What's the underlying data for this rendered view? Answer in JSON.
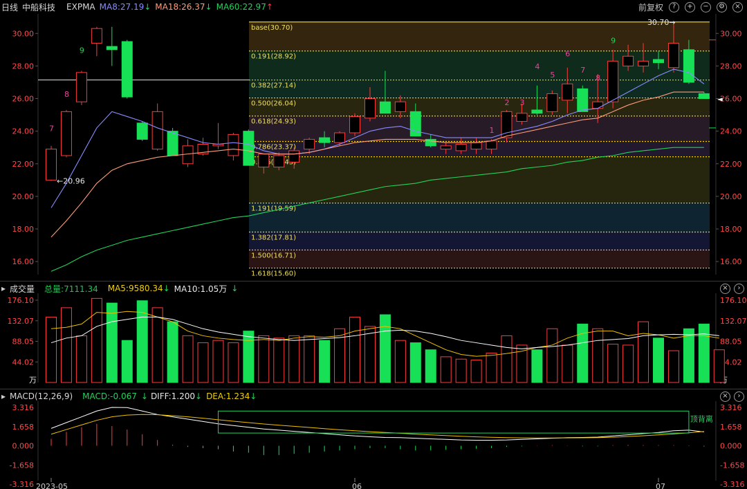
{
  "header": {
    "period_label": "日线",
    "stock_name": "中船科技",
    "indicator": "EXPMA",
    "ma8": "MA8:27.19",
    "ma18": "MA18:26.37",
    "ma60": "MA60:22.97",
    "arrow_down": "↓",
    "arrow_up": "↑",
    "adjust_label": "前复权",
    "ma8_color": "#8a8cff",
    "ma18_color": "#ff9c7a",
    "ma60_color": "#22d35a"
  },
  "price_axis": {
    "ticks": [
      "30.00",
      "28.00",
      "26.00",
      "24.00",
      "22.00",
      "20.00",
      "18.00",
      "16.00"
    ],
    "tick_values": [
      30,
      28,
      26,
      24,
      22,
      20,
      18,
      16
    ],
    "ylim": [
      15.2,
      31.2
    ]
  },
  "price_annotations": {
    "low_label": "←20.96",
    "high_label": "30.70→",
    "current_marker": "◄"
  },
  "fib_levels": [
    {
      "label": "base(30.70)",
      "value": 30.7
    },
    {
      "label": "0.191(28.92)",
      "value": 28.92
    },
    {
      "label": "0.382(27.14)",
      "value": 27.14
    },
    {
      "label": "0.500(26.04)",
      "value": 26.04
    },
    {
      "label": "0.618(24.93)",
      "value": 24.93
    },
    {
      "label": "0.786(23.37)",
      "value": 23.37
    },
    {
      "label": "0.886(22.43)",
      "value": 22.43
    },
    {
      "label": "1.191(19.59)",
      "value": 19.59
    },
    {
      "label": "1.382(17.81)",
      "value": 17.81
    },
    {
      "label": "1.500(16.71)",
      "value": 16.71
    },
    {
      "label": "1.618(15.60)",
      "value": 15.6
    }
  ],
  "chart_data": [
    {
      "type": "candlestick",
      "title": "日线 中船科技",
      "ylim": [
        15.2,
        31.2
      ],
      "candles": [
        {
          "o": 21.0,
          "h": 23.1,
          "l": 20.96,
          "c": 22.9
        },
        {
          "o": 22.5,
          "h": 25.3,
          "l": 22.4,
          "c": 25.2
        },
        {
          "o": 25.8,
          "h": 27.7,
          "l": 25.6,
          "c": 27.6
        },
        {
          "o": 29.4,
          "h": 30.4,
          "l": 28.6,
          "c": 30.3
        },
        {
          "o": 29.2,
          "h": 30.4,
          "l": 28.0,
          "c": 29.0
        },
        {
          "o": 29.5,
          "h": 29.6,
          "l": 26.0,
          "c": 26.1
        },
        {
          "o": 24.5,
          "h": 24.6,
          "l": 23.4,
          "c": 23.5
        },
        {
          "o": 22.9,
          "h": 25.7,
          "l": 22.8,
          "c": 25.2
        },
        {
          "o": 24.0,
          "h": 24.2,
          "l": 22.5,
          "c": 22.5
        },
        {
          "o": 22.0,
          "h": 23.5,
          "l": 21.8,
          "c": 23.1
        },
        {
          "o": 22.6,
          "h": 23.6,
          "l": 22.5,
          "c": 23.2
        },
        {
          "o": 23.1,
          "h": 24.5,
          "l": 22.9,
          "c": 23.2
        },
        {
          "o": 22.5,
          "h": 23.9,
          "l": 22.2,
          "c": 23.8
        },
        {
          "o": 24.0,
          "h": 24.1,
          "l": 21.9,
          "c": 21.9
        },
        {
          "o": 21.8,
          "h": 22.6,
          "l": 21.4,
          "c": 22.6
        },
        {
          "o": 21.8,
          "h": 22.7,
          "l": 21.6,
          "c": 22.5
        },
        {
          "o": 22.1,
          "h": 23.0,
          "l": 21.7,
          "c": 22.8
        },
        {
          "o": 22.9,
          "h": 23.6,
          "l": 22.6,
          "c": 23.5
        },
        {
          "o": 23.6,
          "h": 24.0,
          "l": 23.0,
          "c": 23.3
        },
        {
          "o": 23.3,
          "h": 24.0,
          "l": 23.1,
          "c": 23.9
        },
        {
          "o": 23.9,
          "h": 25.1,
          "l": 23.7,
          "c": 24.9
        },
        {
          "o": 24.8,
          "h": 26.7,
          "l": 24.6,
          "c": 26.0
        },
        {
          "o": 25.8,
          "h": 27.7,
          "l": 25.1,
          "c": 25.1
        },
        {
          "o": 25.2,
          "h": 26.2,
          "l": 24.8,
          "c": 25.8
        },
        {
          "o": 25.2,
          "h": 25.7,
          "l": 23.7,
          "c": 23.7
        },
        {
          "o": 23.5,
          "h": 23.8,
          "l": 23.0,
          "c": 23.1
        },
        {
          "o": 22.9,
          "h": 23.3,
          "l": 22.6,
          "c": 23.1
        },
        {
          "o": 22.8,
          "h": 23.6,
          "l": 22.6,
          "c": 23.2
        },
        {
          "o": 22.9,
          "h": 23.6,
          "l": 22.6,
          "c": 23.3
        },
        {
          "o": 22.9,
          "h": 23.5,
          "l": 22.6,
          "c": 23.4
        },
        {
          "o": 23.6,
          "h": 25.3,
          "l": 23.3,
          "c": 25.2
        },
        {
          "o": 24.6,
          "h": 25.7,
          "l": 24.4,
          "c": 25.1
        },
        {
          "o": 25.3,
          "h": 26.8,
          "l": 25.0,
          "c": 25.1
        },
        {
          "o": 25.2,
          "h": 26.5,
          "l": 25.0,
          "c": 26.3
        },
        {
          "o": 25.9,
          "h": 27.9,
          "l": 25.1,
          "c": 26.9
        },
        {
          "o": 26.6,
          "h": 26.8,
          "l": 25.2,
          "c": 25.2
        },
        {
          "o": 25.4,
          "h": 27.5,
          "l": 24.5,
          "c": 25.8
        },
        {
          "o": 25.8,
          "h": 29.0,
          "l": 25.4,
          "c": 28.3
        },
        {
          "o": 28.0,
          "h": 29.3,
          "l": 27.7,
          "c": 28.6
        },
        {
          "o": 28.0,
          "h": 29.4,
          "l": 27.6,
          "c": 28.3
        },
        {
          "o": 28.4,
          "h": 28.9,
          "l": 27.8,
          "c": 28.2
        },
        {
          "o": 27.9,
          "h": 30.7,
          "l": 27.6,
          "c": 29.4
        },
        {
          "o": 29.0,
          "h": 29.6,
          "l": 26.9,
          "c": 27.0
        },
        {
          "o": 26.3,
          "h": 26.4,
          "l": 26.0,
          "c": 26.0
        }
      ],
      "series": [
        {
          "name": "MA8",
          "values": [
            19.3,
            20.8,
            22.5,
            24.2,
            25.2,
            24.9,
            24.6,
            24.2,
            23.9,
            23.6,
            23.3,
            23.2,
            23.3,
            23.2,
            22.8,
            22.6,
            22.6,
            22.7,
            22.9,
            23.2,
            23.6,
            24.0,
            24.2,
            24.3,
            24.0,
            23.8,
            23.6,
            23.6,
            23.6,
            23.6,
            23.9,
            24.1,
            24.3,
            24.6,
            25.0,
            25.3,
            25.4,
            25.9,
            26.4,
            26.9,
            27.4,
            27.8,
            27.6,
            26.9
          ]
        },
        {
          "name": "MA18",
          "values": [
            17.5,
            18.5,
            19.6,
            20.8,
            21.6,
            22.0,
            22.2,
            22.4,
            22.5,
            22.6,
            22.7,
            22.8,
            22.9,
            22.8,
            22.6,
            22.6,
            22.6,
            22.7,
            22.9,
            23.1,
            23.3,
            23.4,
            23.5,
            23.5,
            23.5,
            23.4,
            23.3,
            23.3,
            23.3,
            23.4,
            23.7,
            23.9,
            24.1,
            24.3,
            24.5,
            24.7,
            24.8,
            25.2,
            25.6,
            25.9,
            26.1,
            26.4,
            26.4,
            26.4
          ]
        },
        {
          "name": "MA60",
          "values": [
            15.4,
            15.8,
            16.3,
            16.7,
            17.0,
            17.3,
            17.5,
            17.7,
            17.9,
            18.1,
            18.3,
            18.5,
            18.7,
            18.8,
            19.0,
            19.2,
            19.4,
            19.6,
            19.8,
            20.0,
            20.2,
            20.4,
            20.6,
            20.7,
            20.8,
            21.0,
            21.1,
            21.2,
            21.3,
            21.4,
            21.5,
            21.7,
            21.8,
            21.9,
            22.1,
            22.2,
            22.4,
            22.5,
            22.7,
            22.8,
            22.9,
            23.0,
            23.0,
            23.0
          ]
        }
      ],
      "sequence_labels": [
        {
          "index": 0,
          "text": "7",
          "value": 24.0
        },
        {
          "index": 1,
          "text": "8",
          "value": 26.1
        },
        {
          "index": 2,
          "text": "9",
          "value": 28.8
        },
        {
          "index": 29,
          "text": "1",
          "value": 23.9
        },
        {
          "index": 30,
          "text": "2",
          "value": 25.6
        },
        {
          "index": 31,
          "text": "3",
          "value": 25.6
        },
        {
          "index": 32,
          "text": "4",
          "value": 27.8
        },
        {
          "index": 33,
          "text": "5",
          "value": 27.3
        },
        {
          "index": 34,
          "text": "6",
          "value": 28.6
        },
        {
          "index": 35,
          "text": "7",
          "value": 27.6
        },
        {
          "index": 36,
          "text": "8",
          "value": 27.1
        },
        {
          "index": 37,
          "text": "9",
          "value": 29.4
        }
      ]
    },
    {
      "type": "bar",
      "title": "成交量",
      "ylim": [
        0,
        185
      ],
      "values": [
        140,
        160,
        100,
        180,
        170,
        90,
        175,
        160,
        130,
        100,
        85,
        90,
        85,
        110,
        100,
        95,
        100,
        100,
        90,
        115,
        140,
        120,
        145,
        90,
        85,
        70,
        55,
        50,
        48,
        63,
        100,
        80,
        70,
        115,
        80,
        125,
        115,
        82,
        80,
        130,
        95,
        68,
        115,
        125,
        70
      ],
      "series": [
        {
          "name": "MA5",
          "values": [
            115,
            118,
            125,
            150,
            148,
            152,
            150,
            140,
            130,
            110,
            100,
            95,
            92,
            90,
            92,
            90,
            95,
            98,
            97,
            100,
            110,
            115,
            120,
            115,
            100,
            85,
            70,
            60,
            56,
            58,
            62,
            67,
            75,
            80,
            95,
            105,
            110,
            110,
            100,
            105,
            102,
            95,
            100,
            100,
            95
          ]
        },
        {
          "name": "MA10",
          "values": [
            85,
            95,
            100,
            120,
            130,
            135,
            140,
            140,
            135,
            125,
            115,
            108,
            103,
            98,
            95,
            92,
            90,
            92,
            94,
            96,
            100,
            105,
            110,
            112,
            110,
            105,
            98,
            90,
            85,
            80,
            75,
            72,
            75,
            77,
            80,
            85,
            90,
            92,
            94,
            100,
            102,
            103,
            102,
            104,
            100
          ]
        }
      ],
      "ticks": [
        "176.10",
        "132.07",
        "88.05",
        "44.02"
      ],
      "tick_values": [
        176.1,
        132.07,
        88.05,
        44.02
      ],
      "unit": "万"
    },
    {
      "type": "bar",
      "title": "MACD(12,26,9)",
      "ylim": [
        -3.316,
        3.316
      ],
      "values": [
        0.6,
        1.2,
        1.6,
        1.9,
        1.7,
        1.4,
        1.0,
        0.5,
        0.1,
        -0.1,
        -0.2,
        -0.3,
        -0.5,
        -0.6,
        -0.8,
        -0.8,
        -0.7,
        -0.6,
        -0.5,
        -0.4,
        -0.3,
        -0.2,
        -0.2,
        -0.3,
        -0.4,
        -0.4,
        -0.35,
        -0.3,
        -0.25,
        -0.2,
        -0.1,
        -0.05,
        0.02,
        0.05,
        0.02,
        -0.05,
        -0.05,
        0.05,
        0.08,
        0.06,
        0.05,
        0.05,
        -0.03,
        -0.067
      ],
      "series": [
        {
          "name": "DIFF",
          "values": [
            1.5,
            2.0,
            2.5,
            3.0,
            3.316,
            3.3,
            3.0,
            2.7,
            2.5,
            2.3,
            2.1,
            1.9,
            1.75,
            1.6,
            1.45,
            1.35,
            1.25,
            1.15,
            1.05,
            0.95,
            0.85,
            0.78,
            0.72,
            0.7,
            0.65,
            0.6,
            0.55,
            0.5,
            0.48,
            0.48,
            0.5,
            0.55,
            0.6,
            0.65,
            0.7,
            0.72,
            0.75,
            0.85,
            0.95,
            1.05,
            1.15,
            1.3,
            1.35,
            1.2
          ]
        },
        {
          "name": "DEA",
          "values": [
            1.0,
            1.4,
            1.8,
            2.2,
            2.5,
            2.65,
            2.7,
            2.68,
            2.6,
            2.5,
            2.38,
            2.25,
            2.12,
            2.0,
            1.88,
            1.78,
            1.68,
            1.58,
            1.48,
            1.38,
            1.3,
            1.22,
            1.15,
            1.08,
            1.0,
            0.94,
            0.88,
            0.82,
            0.77,
            0.73,
            0.7,
            0.68,
            0.67,
            0.67,
            0.68,
            0.69,
            0.7,
            0.74,
            0.8,
            0.87,
            0.94,
            1.02,
            1.12,
            1.234
          ]
        }
      ],
      "ticks": [
        "3.316",
        "1.658",
        "0.000",
        "-1.658",
        "-3.316"
      ],
      "tick_values": [
        3.316,
        1.658,
        0,
        -1.658,
        -3.316
      ]
    }
  ],
  "volume_header": {
    "title": "成交量",
    "total": "总量:7111.34",
    "ma5": "MA5:9580.34",
    "ma5_arrow": "↓",
    "ma10": "MA10:1.05万",
    "ma10_arrow": "↓",
    "unit": "万"
  },
  "macd_header": {
    "title": "MACD(12,26,9)",
    "macd": "MACD:-0.067",
    "diff": "DIFF:1.200",
    "dea": "DEA:1.234",
    "arrow": "↓",
    "divergence_label": "顶背离"
  },
  "date_axis": {
    "labels": [
      "2023-05",
      "06",
      "07"
    ]
  },
  "colors": {
    "up": "#ff3b3b",
    "down": "#17e056",
    "fib_line": "#f0d000",
    "axis_text": "#ff4a4a"
  }
}
